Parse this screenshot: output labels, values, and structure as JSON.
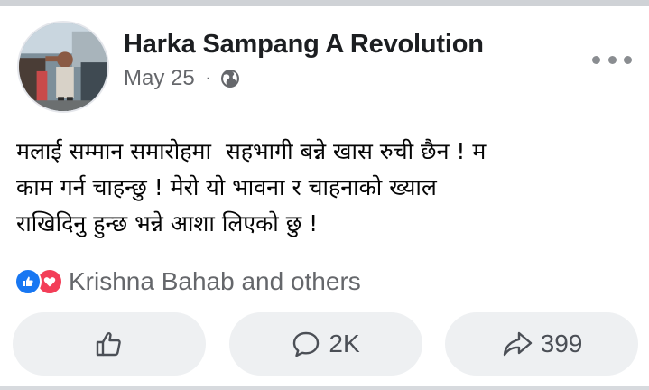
{
  "post": {
    "author": "Harka Sampang A Revolution",
    "date": "May 25",
    "separator": "·",
    "privacy_icon": "globe-icon",
    "text": "मलाई सम्मान समारोहमा  सहभागी बन्ने खास रुची छैन ! म\nकाम गर्न चाहन्छु ! मेरो यो भावना र चाहनाको ख्याल\nराखिदिनु हुन्छ भन्ने आशा लिएको छु !"
  },
  "reactions": {
    "icons": [
      "like-reaction-icon",
      "love-reaction-icon"
    ],
    "summary": "Krishna Bahab and others"
  },
  "actions": {
    "like_icon": "thumbs-up-icon",
    "comment_icon": "comment-icon",
    "comment_count": "2K",
    "share_icon": "share-icon",
    "share_count": "399"
  },
  "colors": {
    "like_blue": "#1877f2",
    "love_red": "#f33e58",
    "secondary_text": "#65676b",
    "button_bg": "#eef0f2"
  }
}
